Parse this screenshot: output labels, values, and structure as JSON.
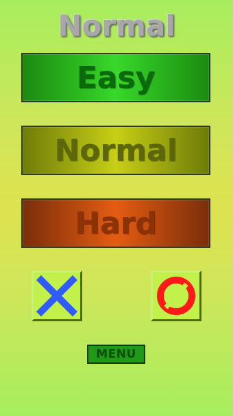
{
  "screen": {
    "title": "Normal"
  },
  "difficulty_buttons": [
    {
      "label": "Easy",
      "color": "#2ec41f"
    },
    {
      "label": "Normal",
      "color": "#b9c414"
    },
    {
      "label": "Hard",
      "color": "#e0560f"
    }
  ],
  "actions": {
    "cancel_icon": "x-icon",
    "confirm_icon": "circle-o-icon",
    "cancel_color": "#2f5bff",
    "confirm_color": "#ff1a1a"
  },
  "menu": {
    "label": "MENU"
  }
}
